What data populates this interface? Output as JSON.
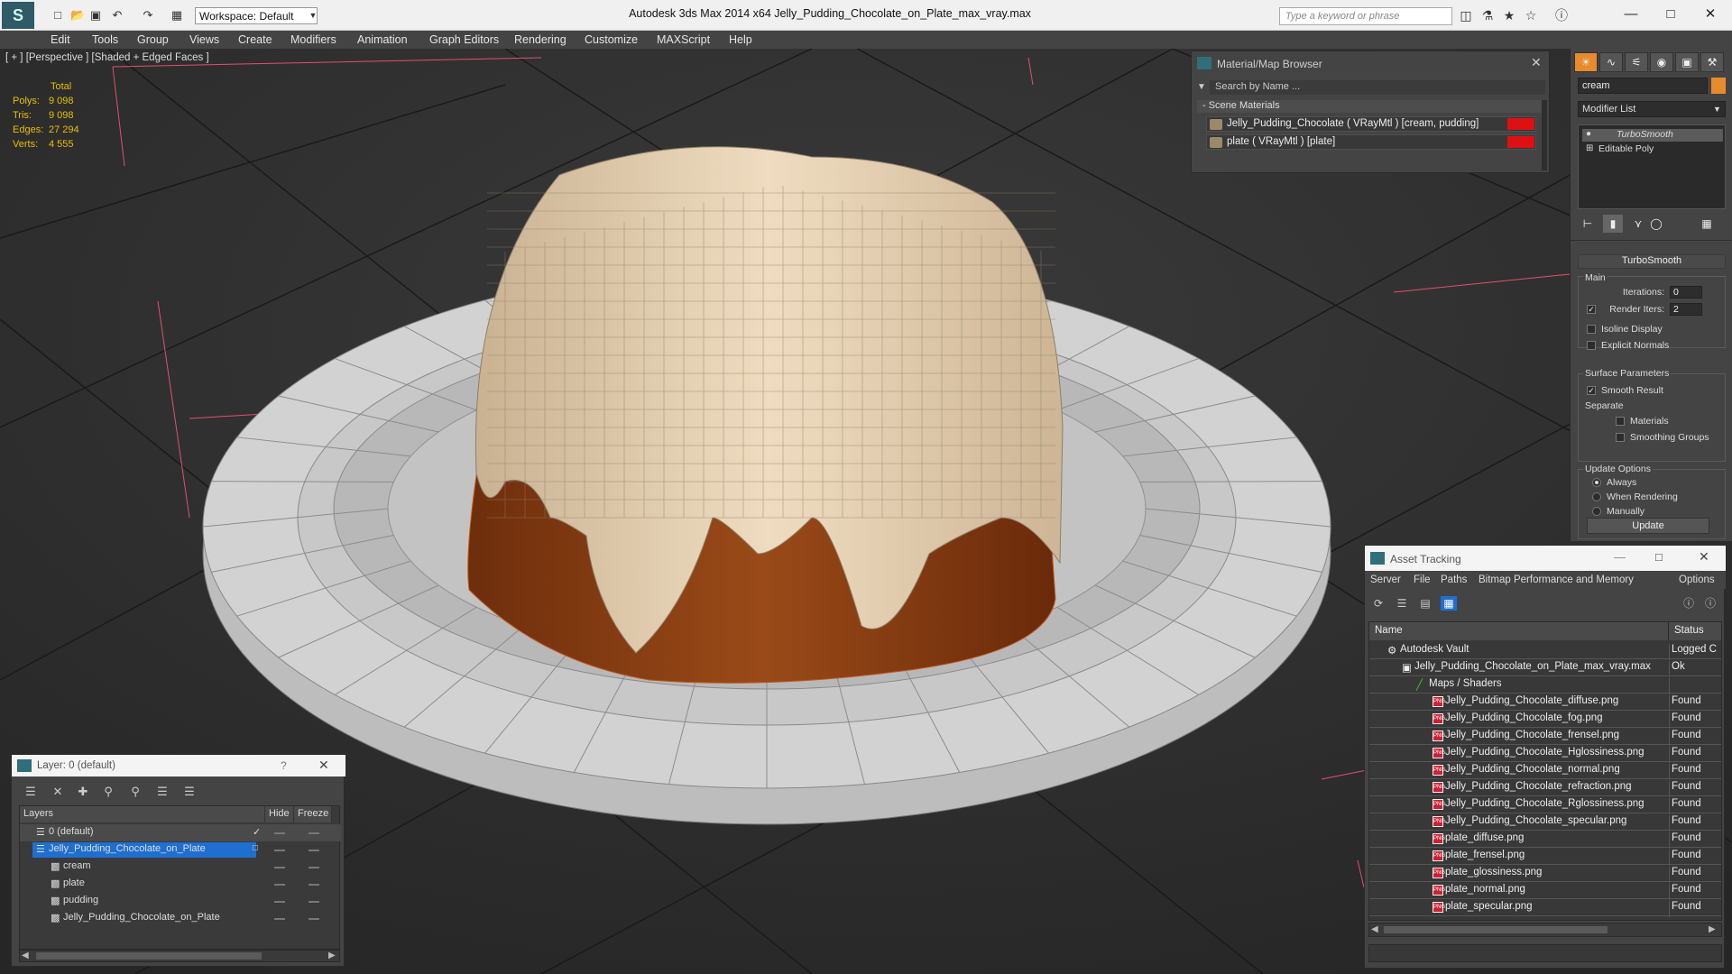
{
  "app": {
    "title": "Autodesk 3ds Max  2014 x64      Jelly_Pudding_Chocolate_on_Plate_max_vray.max",
    "workspace": "Workspace: Default",
    "search_placeholder": "Type a keyword or phrase"
  },
  "menu": [
    "Edit",
    "Tools",
    "Group",
    "Views",
    "Create",
    "Modifiers",
    "Animation",
    "Graph Editors",
    "Rendering",
    "Customize",
    "MAXScript",
    "Help"
  ],
  "viewport": {
    "label": "[ + ] [Perspective ] [Shaded + Edged Faces ]",
    "stats_header": "Total",
    "stats": [
      {
        "key": "Polys:",
        "value": "9 098"
      },
      {
        "key": "Tris:",
        "value": "9 098"
      },
      {
        "key": "Edges:",
        "value": "27 294"
      },
      {
        "key": "Verts:",
        "value": "4 555"
      }
    ]
  },
  "material_browser": {
    "title": "Material/Map Browser",
    "search_placeholder": "Search by Name ...",
    "group": "- Scene Materials",
    "items": [
      "Jelly_Pudding_Chocolate  ( VRayMtl )  [cream, pudding]",
      "plate  ( VRayMtl )  [plate]"
    ]
  },
  "command_panel": {
    "object_name": "cream",
    "modifier_list": "Modifier List",
    "stack": [
      "TurboSmooth",
      "Editable Poly"
    ],
    "rollout": "TurboSmooth",
    "main_label": "Main",
    "iterations_label": "Iterations:",
    "iterations_value": "0",
    "render_iters_label": "Render Iters:",
    "render_iters_value": "2",
    "isoline": "Isoline Display",
    "explicit_normals": "Explicit Normals",
    "surface_params": "Surface Parameters",
    "smooth_result": "Smooth Result",
    "separate": "Separate",
    "materials": "Materials",
    "smoothing_groups": "Smoothing Groups",
    "update_options": "Update Options",
    "always": "Always",
    "when_rendering": "When Rendering",
    "manually": "Manually",
    "update_button": "Update"
  },
  "layer_panel": {
    "title": "Layer: 0 (default)",
    "help": "?",
    "columns": [
      "Layers",
      "Hide",
      "Freeze"
    ],
    "rows": [
      "0 (default)",
      "Jelly_Pudding_Chocolate_on_Plate",
      "cream",
      "plate",
      "pudding",
      "Jelly_Pudding_Chocolate_on_Plate"
    ]
  },
  "asset_tracking": {
    "title": "Asset Tracking",
    "menu": [
      "Server",
      "File",
      "Paths",
      "Bitmap Performance and Memory",
      "Options"
    ],
    "columns": [
      "Name",
      "Status"
    ],
    "rows": [
      {
        "name": "Autodesk Vault",
        "status": "Logged C"
      },
      {
        "name": "Jelly_Pudding_Chocolate_on_Plate_max_vray.max",
        "status": "Ok"
      },
      {
        "name": "Maps / Shaders",
        "status": ""
      },
      {
        "name": "Jelly_Pudding_Chocolate_diffuse.png",
        "status": "Found"
      },
      {
        "name": "Jelly_Pudding_Chocolate_fog.png",
        "status": "Found"
      },
      {
        "name": "Jelly_Pudding_Chocolate_frensel.png",
        "status": "Found"
      },
      {
        "name": "Jelly_Pudding_Chocolate_Hglossiness.png",
        "status": "Found"
      },
      {
        "name": "Jelly_Pudding_Chocolate_normal.png",
        "status": "Found"
      },
      {
        "name": "Jelly_Pudding_Chocolate_refraction.png",
        "status": "Found"
      },
      {
        "name": "Jelly_Pudding_Chocolate_Rglossiness.png",
        "status": "Found"
      },
      {
        "name": "Jelly_Pudding_Chocolate_specular.png",
        "status": "Found"
      },
      {
        "name": "plate_diffuse.png",
        "status": "Found"
      },
      {
        "name": "plate_frensel.png",
        "status": "Found"
      },
      {
        "name": "plate_glossiness.png",
        "status": "Found"
      },
      {
        "name": "plate_normal.png",
        "status": "Found"
      },
      {
        "name": "plate_specular.png",
        "status": "Found"
      }
    ]
  },
  "colors": {
    "accent": "#e88b2c",
    "selection": "#1e6fd0",
    "swatch": "#d11111",
    "stats": "#e8c000"
  }
}
